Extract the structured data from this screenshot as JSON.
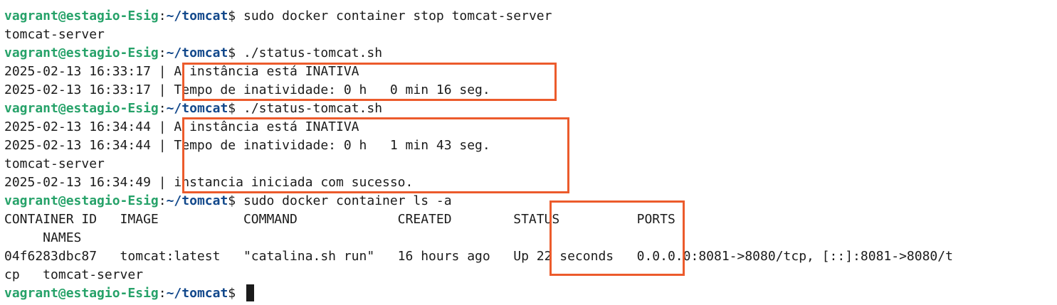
{
  "prompt": {
    "user_host": "vagrant@estagio-Esig",
    "path": "~/tomcat",
    "symbol": "$ "
  },
  "colors": {
    "user": "#26a269",
    "path": "#12488b",
    "text": "#1b1b1b",
    "highlight": "#ec5b2c"
  },
  "commands": {
    "c1": "sudo docker container stop tomcat-server",
    "c2": "./status-tomcat.sh",
    "c3": "./status-tomcat.sh",
    "c4": "sudo docker container ls -a"
  },
  "output": {
    "l2": "tomcat-server",
    "l4": "2025-02-13 16:33:17 | A instância está INATIVA",
    "l5": "2025-02-13 16:33:17 | Tempo de inatividade: 0 h   0 min 16 seg.",
    "l7": "2025-02-13 16:34:44 | A instância está INATIVA",
    "l8": "2025-02-13 16:34:44 | Tempo de inatividade: 0 h   1 min 43 seg.",
    "l9": "tomcat-server",
    "l10": "2025-02-13 16:34:49 | instancia iniciada com sucesso.",
    "l12": "CONTAINER ID   IMAGE           COMMAND             CREATED        STATUS          PORTS",
    "l13": "     NAMES",
    "l14": "04f6283dbc87   tomcat:latest   \"catalina.sh run\"   16 hours ago   Up 22 seconds   0.0.0.0:8081->8080/tcp, [::]:8081->8080/t",
    "l15": "cp   tomcat-server"
  }
}
